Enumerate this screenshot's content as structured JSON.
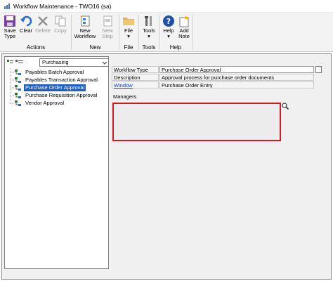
{
  "window": {
    "title": "Workflow Maintenance  -  TWO16 (sa)"
  },
  "ribbon": {
    "groups": {
      "actions": "Actions",
      "new": "New",
      "file": "File",
      "tools": "Tools",
      "help": "Help"
    },
    "buttons": {
      "save_l1": "Save",
      "save_l2": "Type",
      "clear": "Clear",
      "delete": "Delete",
      "copy": "Copy",
      "new_workflow_l1": "New",
      "new_workflow_l2": "Workflow",
      "new_step_l1": "New",
      "new_step_l2": "Step",
      "file": "File",
      "tools": "Tools",
      "help": "Help",
      "add_note_l1": "Add",
      "add_note_l2": "Note"
    },
    "colors": {
      "save_icon": "#7b3fa0",
      "clear_icon": "#2a6fc9",
      "help_icon": "#1f4fa8"
    }
  },
  "tree": {
    "series_selected": "Purchasing",
    "items": [
      {
        "label": "Payables Batch Approval"
      },
      {
        "label": "Payables Transaction Approval"
      },
      {
        "label": "Purchase Order Approval"
      },
      {
        "label": "Purchase Requisition Approval"
      },
      {
        "label": "Vendor Approval"
      }
    ],
    "selected_index": 2
  },
  "form": {
    "workflow_type_label": "Workflow Type",
    "workflow_type_value": "Purchase Order Approval",
    "description_label": "Description",
    "description_value": "Approval process for purchase order documents",
    "window_label": "Window",
    "window_value": "Purchase Order Entry",
    "managers_label": "Managers"
  },
  "colors": {
    "selection": "#1f5fc2",
    "highlight_border": "#d31a22",
    "link": "#0044cc"
  }
}
